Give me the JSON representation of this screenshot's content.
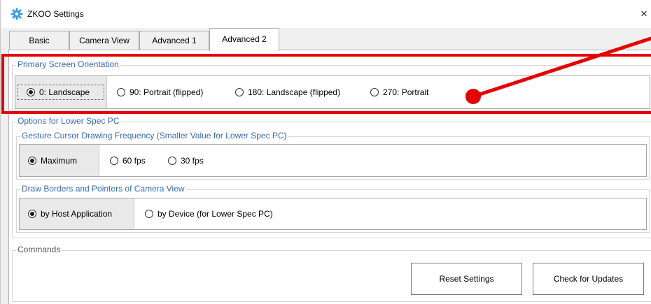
{
  "window": {
    "title": "ZKOO Settings",
    "close_glyph": "×",
    "icon": "gear-icon",
    "icon_color": "#3a9ee4"
  },
  "tabs": [
    {
      "label": "Basic",
      "active": false
    },
    {
      "label": "Camera View",
      "active": false
    },
    {
      "label": "Advanced 1",
      "active": false
    },
    {
      "label": "Advanced 2",
      "active": true
    }
  ],
  "orientation": {
    "legend": "Primary Screen Orientation",
    "options": [
      "0: Landscape",
      "90: Portrait (flipped)",
      "180: Landscape (flipped)",
      "270: Portrait"
    ],
    "selected": "0: Landscape"
  },
  "lower_spec": {
    "legend": "Options for Lower Spec PC",
    "frequency": {
      "legend": "Gesture Cursor Drawing Frequency (Smaller Value for Lower Spec PC)",
      "options": [
        "Maximum",
        "60 fps",
        "30 fps"
      ],
      "selected": "Maximum"
    },
    "borders": {
      "legend": "Draw Borders and Pointers of Camera View",
      "options": [
        "by Host Application",
        "by Device (for Lower Spec PC)"
      ],
      "selected": "by Host Application"
    }
  },
  "commands": {
    "legend": "Commands",
    "reset_label": "Reset Settings",
    "update_label": "Check for Updates"
  },
  "annotation": {
    "color": "#e60000"
  }
}
